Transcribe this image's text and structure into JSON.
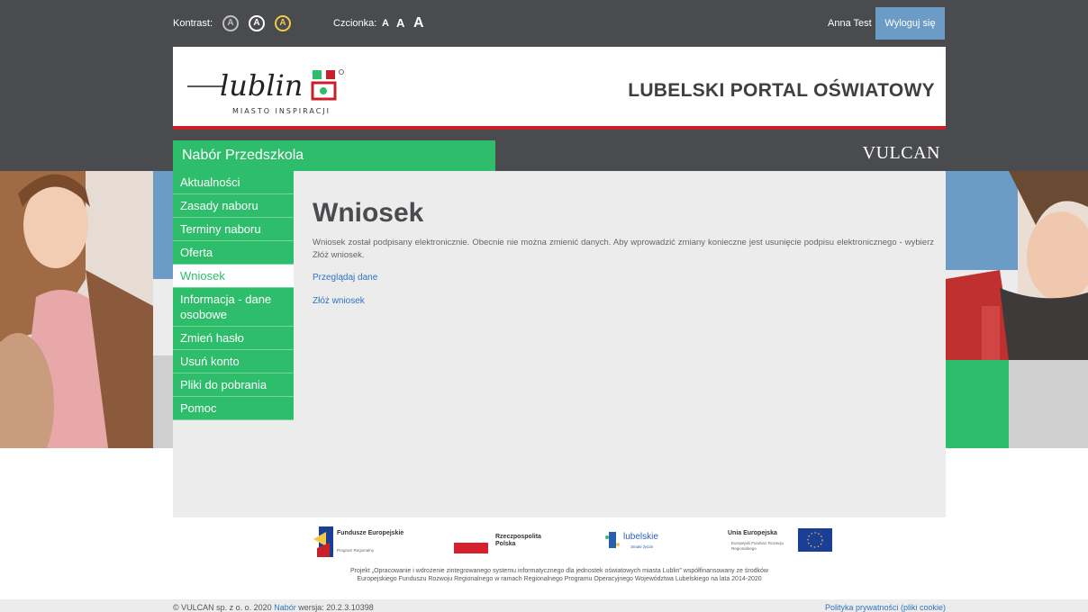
{
  "topbar": {
    "contrast_label": "Kontrast:",
    "contrast_buttons": [
      "A",
      "A",
      "A"
    ],
    "font_label": "Czcionka:",
    "font_sizes": [
      "A",
      "A",
      "A"
    ],
    "user_name": "Anna Test",
    "logout_label": "Wyloguj się"
  },
  "header": {
    "logo_text": "lublin",
    "logo_subtitle": "MIASTO INSPIRACJI",
    "portal_title": "LUBELSKI PORTAL OŚWIATOWY"
  },
  "module": {
    "title": "Nabór Przedszkola",
    "vendor_logo": "VULCAN"
  },
  "sidebar": {
    "items": [
      {
        "label": "Aktualności"
      },
      {
        "label": "Zasady naboru"
      },
      {
        "label": "Terminy naboru"
      },
      {
        "label": "Oferta"
      },
      {
        "label": "Wniosek",
        "active": true
      },
      {
        "label": "Informacja - dane osobowe"
      },
      {
        "label": "Zmień hasło"
      },
      {
        "label": "Usuń konto"
      },
      {
        "label": "Pliki do pobrania"
      },
      {
        "label": "Pomoc"
      }
    ]
  },
  "main": {
    "heading": "Wniosek",
    "text": "Wniosek został podpisany elektronicznie. Obecnie nie można zmienić danych. Aby wprowadzić zmiany konieczne jest usunięcie podpisu elektronicznego - wybierz Złóż wniosek.",
    "link_view": "Przeglądaj dane",
    "link_submit": "Złóż wniosek"
  },
  "footer": {
    "logos": [
      {
        "title": "Fundusze Europejskie",
        "subtitle": "Program Regionalny"
      },
      {
        "title": "Rzeczpospolita Polska",
        "subtitle": ""
      },
      {
        "title": "lubelskie",
        "subtitle": "Smaki życia!"
      },
      {
        "title": "Unia Europejska",
        "subtitle": "Europejski Fundusz Rozwoju Regionalnego"
      }
    ],
    "project_line1": "Projekt „Opracowanie i wdrożenie zintegrowanego systemu informatycznego dla jednostek oświatowych miasta Lublin\" współfinansowany ze środków",
    "project_line2": "Europejskiego Funduszu Rozwoju Regionalnego w ramach Regionalnego Programu Operacyjnego Województwa Lubelskiego na lata 2014-2020",
    "copyright_prefix": "© VULCAN sp. z o. o. 2020",
    "copyright_link": "Nabór",
    "version": "wersja: 20.2.3.10398",
    "privacy_link": "Polityka prywatności (pliki cookie)"
  },
  "colors": {
    "green": "#2ebd6b",
    "dark": "#4a4b4f",
    "blue": "#6c9cc6",
    "red": "#c8202b",
    "link": "#2f74c0"
  }
}
